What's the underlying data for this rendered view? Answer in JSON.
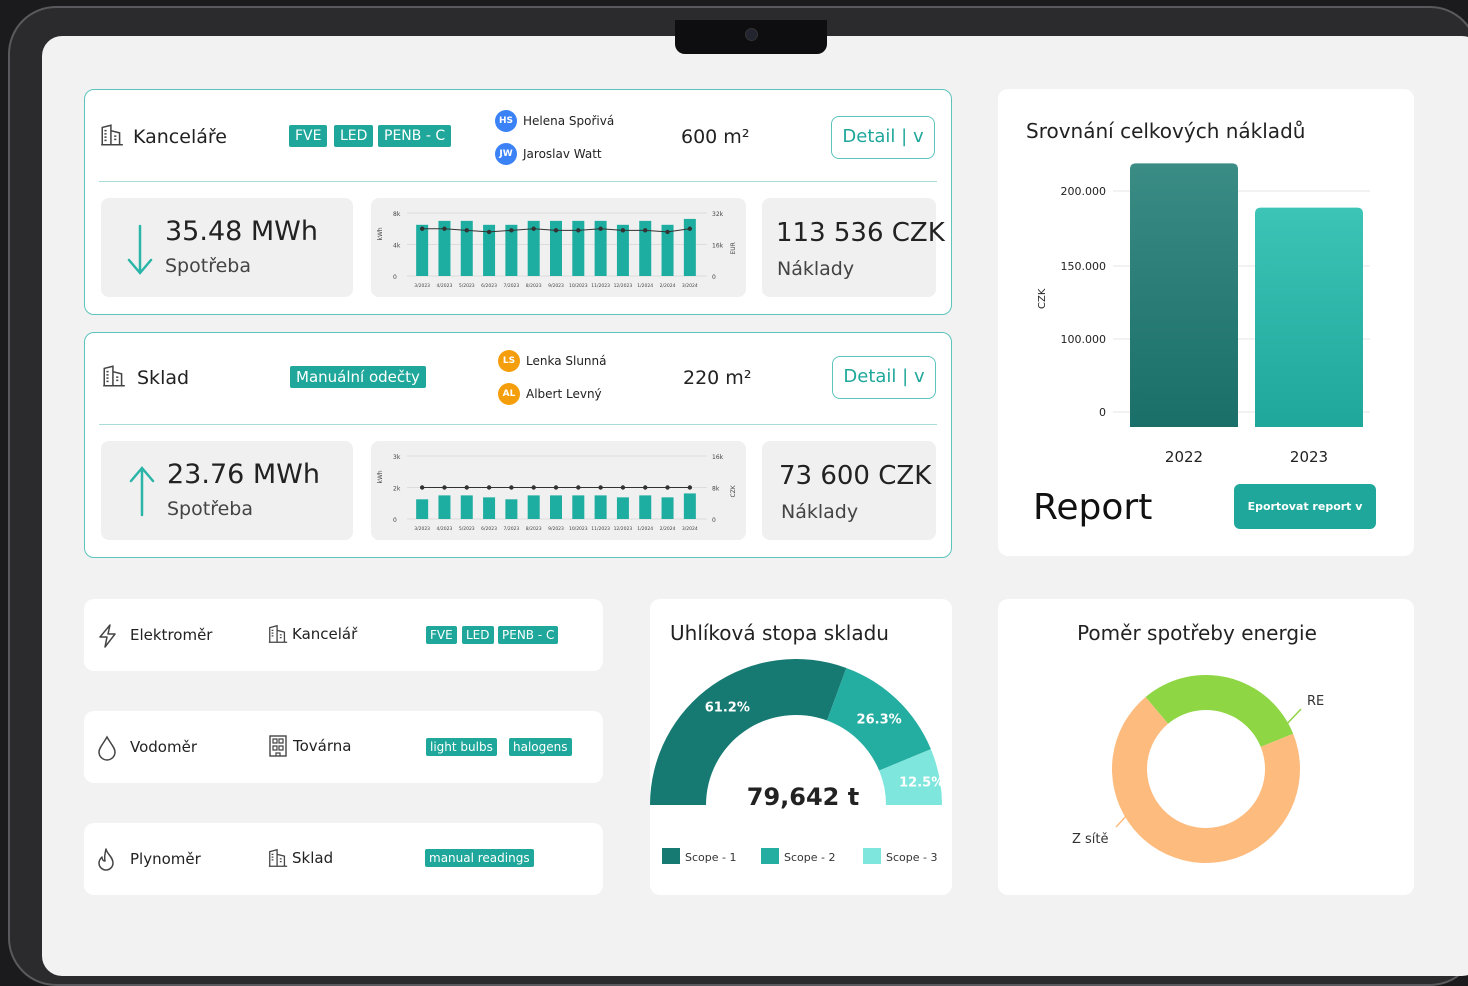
{
  "buildings": [
    {
      "name": "Kanceláře",
      "tags": [
        "FVE",
        "LED",
        "PENB - C"
      ],
      "people": [
        {
          "initials": "HS",
          "name": "Helena Spořivá",
          "color": "#3b82f6"
        },
        {
          "initials": "JW",
          "name": "Jaroslav Watt",
          "color": "#3b82f6"
        }
      ],
      "area": "600 m²",
      "detail_label": "Detail | v",
      "consumption_value": "35.48 MWh",
      "consumption_label": "Spotřeba",
      "cost_value": "113 536 CZK",
      "cost_label": "Náklady",
      "mini_chart": {
        "left_ticks": [
          "8k",
          "4k",
          "0"
        ],
        "right_ticks": [
          "32k",
          "16k",
          "0"
        ],
        "left_unit": "kWh",
        "right_unit": "EUR"
      }
    },
    {
      "name": "Sklad",
      "tags": [
        "Manuální odečty"
      ],
      "people": [
        {
          "initials": "LS",
          "name": "Lenka Slunná",
          "color": "#f59e0b"
        },
        {
          "initials": "AL",
          "name": "Albert Levný",
          "color": "#f59e0b"
        }
      ],
      "area": "220 m²",
      "detail_label": "Detail | v",
      "consumption_value": "23.76 MWh",
      "consumption_label": "Spotřeba",
      "cost_value": "73 600 CZK",
      "cost_label": "Náklady",
      "mini_chart": {
        "left_ticks": [
          "3k",
          "2k",
          "0"
        ],
        "right_ticks": [
          "16k",
          "8k",
          "0"
        ],
        "left_unit": "kWh",
        "right_unit": "CZK"
      }
    }
  ],
  "meters": [
    {
      "type": "Elektroměr",
      "icon": "lightning-icon",
      "building": "Kancelář",
      "building_icon": "building-icon",
      "tags": [
        "FVE",
        "LED",
        "PENB - C"
      ]
    },
    {
      "type": "Vodoměr",
      "icon": "water-drop-icon",
      "building": "Továrna",
      "building_icon": "factory-icon",
      "tags": [
        "light bulbs",
        "halogens"
      ]
    },
    {
      "type": "Plynoměr",
      "icon": "flame-icon",
      "building": "Sklad",
      "building_icon": "building-icon",
      "tags": [
        "manual readings"
      ]
    }
  ],
  "cost_comparison": {
    "title": "Srovnání celkových nákladů",
    "report_label": "Report",
    "export_button": "Eportovat report v PDF"
  },
  "carbon": {
    "title": "Uhlíková stopa skladu",
    "total": "79,642 t"
  },
  "energy_ratio": {
    "title": "Poměr spotřeby energie"
  },
  "colors": {
    "accent": "#1ea79a",
    "dark_teal": "#167a73",
    "light_teal": "#7fe6dd",
    "green": "#8fd645",
    "orange": "#fdbb7e"
  },
  "chart_data": [
    {
      "type": "bar",
      "title": "",
      "categories": [
        "3/2023",
        "4/2023",
        "5/2023",
        "6/2023",
        "7/2023",
        "8/2023",
        "9/2023",
        "10/2023",
        "11/2023",
        "12/2023",
        "1/2024",
        "2/2024",
        "3/2024"
      ],
      "series": [
        {
          "values": [
            6000,
            6000,
            5800,
            5600,
            5800,
            6000,
            5800,
            5800,
            6000,
            5800,
            5800,
            5600,
            6000
          ]
        },
        {
          "values": [
            26000,
            28000,
            28000,
            26000,
            26000,
            28000,
            28000,
            28000,
            28000,
            26000,
            28000,
            26000,
            29000
          ]
        }
      ],
      "ylabel": "kWh",
      "ylabel_right": "EUR",
      "ylim": [
        0,
        8000
      ],
      "ylim_right": [
        0,
        32000
      ]
    },
    {
      "type": "bar",
      "title": "",
      "categories": [
        "3/2023",
        "4/2023",
        "5/2023",
        "6/2023",
        "7/2023",
        "8/2023",
        "9/2023",
        "10/2023",
        "11/2023",
        "12/2023",
        "1/2024",
        "2/2024",
        "3/2024"
      ],
      "series": [
        {
          "values": [
            1500,
            1500,
            1500,
            1500,
            1500,
            1500,
            1500,
            1500,
            1500,
            1500,
            1500,
            1500,
            1500
          ]
        },
        {
          "values": [
            5000,
            6000,
            6000,
            5500,
            5000,
            6000,
            6000,
            6000,
            6000,
            5500,
            6000,
            5500,
            6500
          ]
        }
      ],
      "ylabel": "kWh",
      "ylabel_right": "CZK",
      "ylim": [
        0,
        3000
      ],
      "ylim_right": [
        0,
        16000
      ]
    },
    {
      "type": "bar",
      "title": "Srovnání celkových nákladů",
      "categories": [
        "2022",
        "2023"
      ],
      "values": [
        225000,
        185000
      ],
      "ylabel": "CZK",
      "yticks": [
        "200.000",
        "150.000",
        "100.000",
        "0"
      ]
    },
    {
      "type": "pie",
      "title": "Uhlíková stopa skladu",
      "labels": [
        "Scope - 1",
        "Scope - 2",
        "Scope - 3"
      ],
      "values": [
        61.2,
        26.3,
        12.5
      ],
      "value_labels": [
        "61.2%",
        "26.3%",
        "12.5%"
      ],
      "center_label": "79,642 t"
    },
    {
      "type": "pie",
      "title": "Poměr spotřeby energie",
      "labels": [
        "RE",
        "Z sítě"
      ],
      "values": [
        30,
        70
      ]
    }
  ]
}
